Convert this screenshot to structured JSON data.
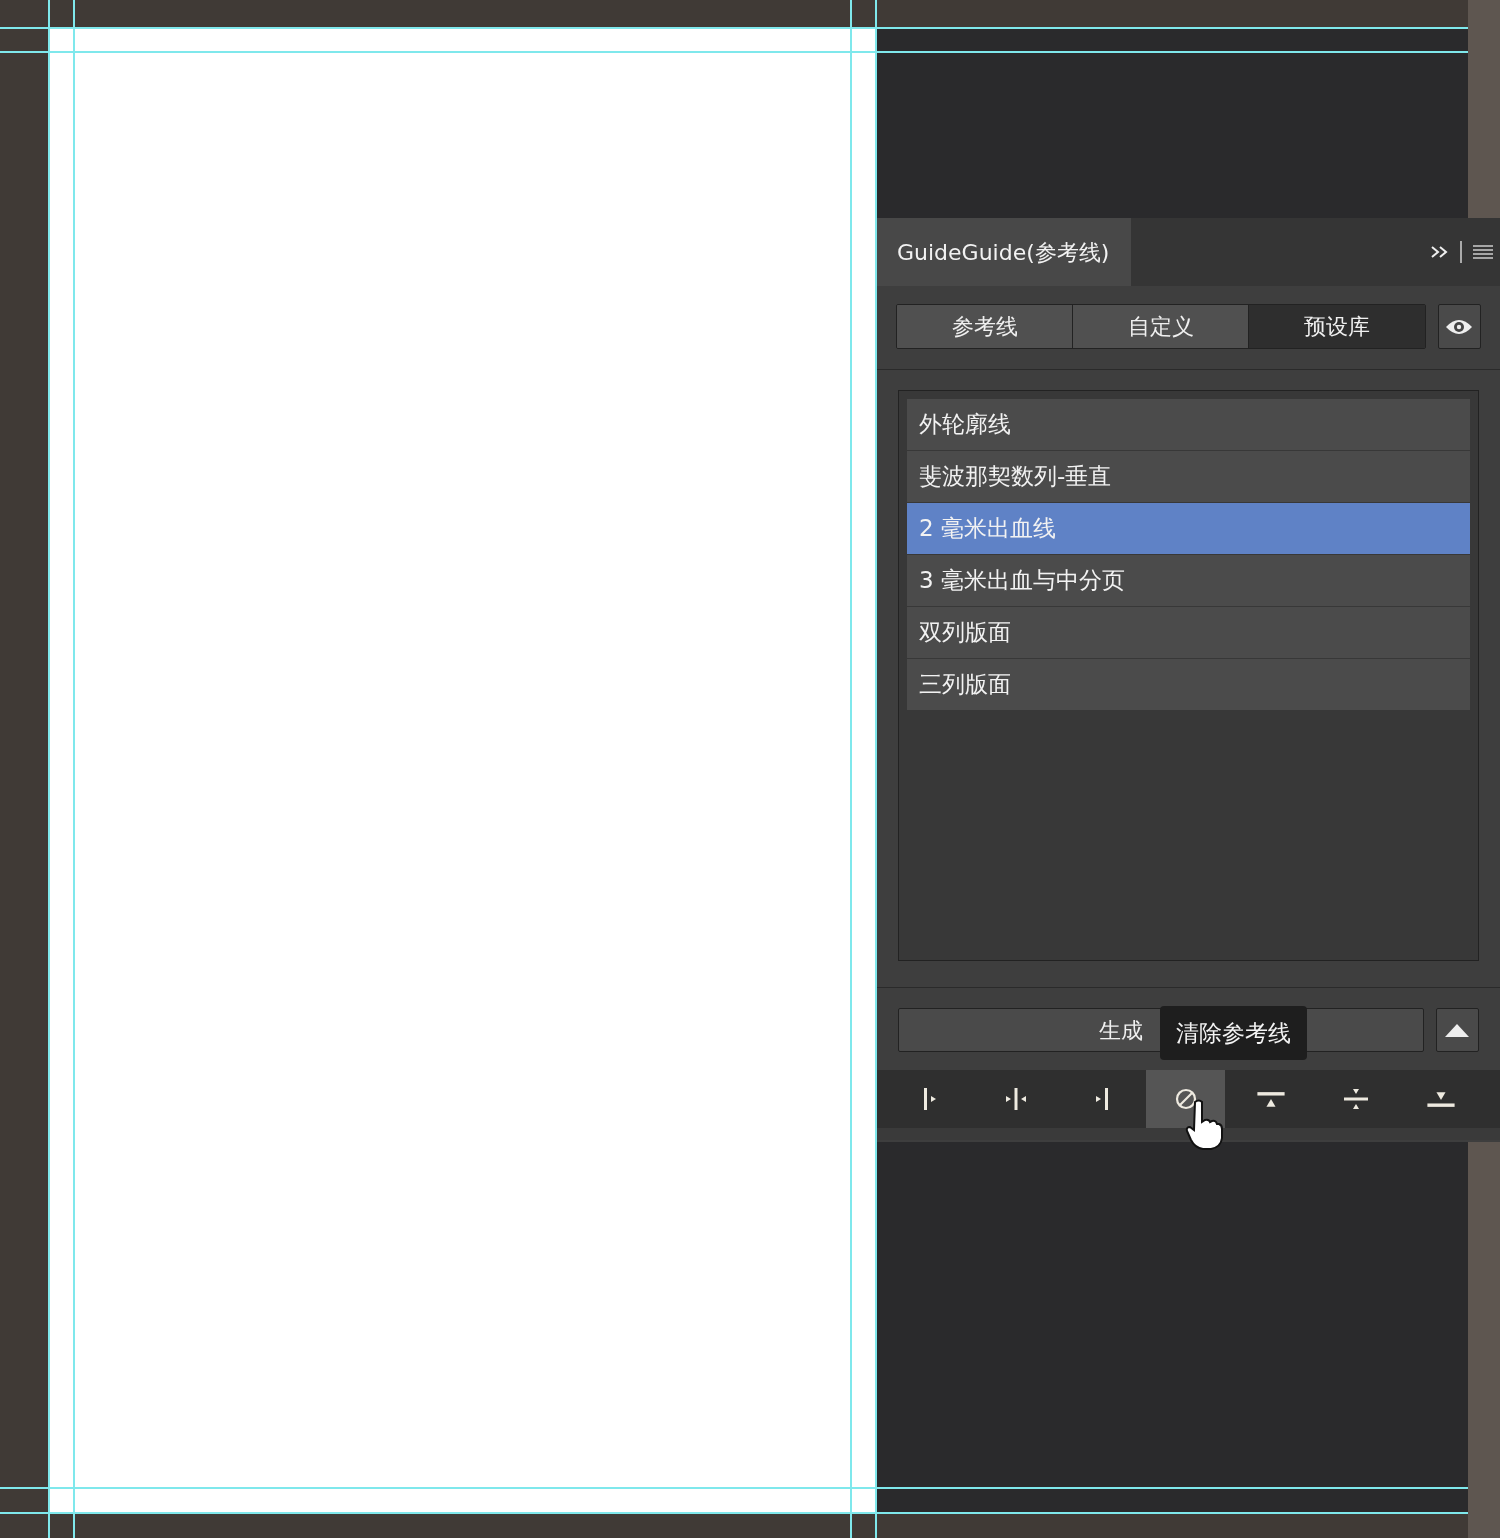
{
  "panel": {
    "title": "GuideGuide(参考线)",
    "tabs": [
      {
        "label": "参考线",
        "selected": false
      },
      {
        "label": "自定义",
        "selected": false
      },
      {
        "label": "预设库",
        "selected": true
      }
    ],
    "presets": [
      {
        "label": "外轮廓线",
        "selected": false
      },
      {
        "label": "斐波那契数列-垂直",
        "selected": false
      },
      {
        "label": "2 毫米出血线",
        "selected": true
      },
      {
        "label": "3 毫米出血与中分页",
        "selected": false
      },
      {
        "label": "双列版面",
        "selected": false
      },
      {
        "label": "三列版面",
        "selected": false
      }
    ],
    "generate_button": "生成",
    "tooltip": "清除参考线",
    "tools": [
      {
        "kind": "left",
        "hovered": false
      },
      {
        "kind": "center-v",
        "hovered": false
      },
      {
        "kind": "right",
        "hovered": false
      },
      {
        "kind": "clear",
        "hovered": true
      },
      {
        "kind": "top",
        "hovered": false
      },
      {
        "kind": "center-h",
        "hovered": false
      },
      {
        "kind": "bottom",
        "hovered": false
      }
    ]
  }
}
